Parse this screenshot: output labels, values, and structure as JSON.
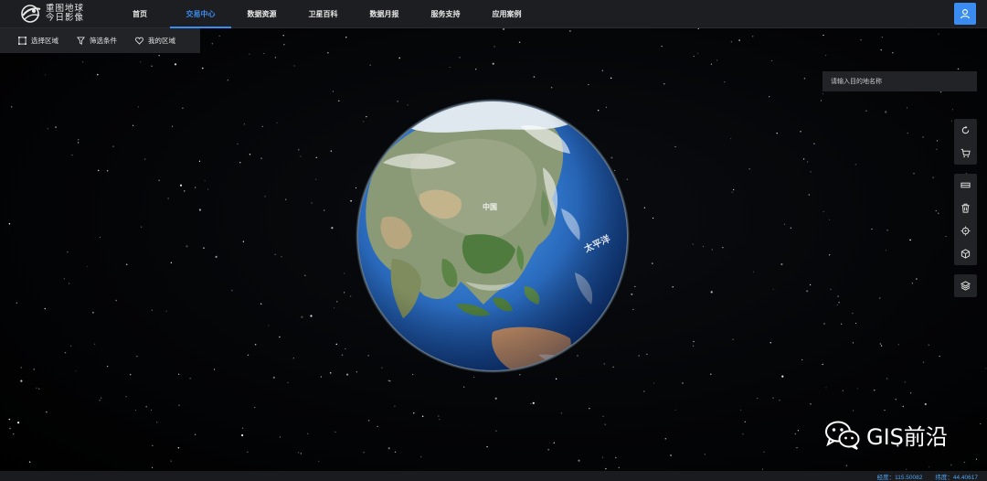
{
  "app": {
    "logo_line1": "重图地球",
    "logo_line2": "今日影像"
  },
  "nav": {
    "items": [
      {
        "label": "首页",
        "active": false
      },
      {
        "label": "交易中心",
        "active": true
      },
      {
        "label": "数据资源",
        "active": false
      },
      {
        "label": "卫星百科",
        "active": false
      },
      {
        "label": "数据月报",
        "active": false
      },
      {
        "label": "服务支持",
        "active": false
      },
      {
        "label": "应用案例",
        "active": false
      }
    ]
  },
  "toolbar": {
    "select_area": "选择区域",
    "filter": "筛选条件",
    "my_area": "我的区域"
  },
  "search": {
    "placeholder": "请输入目的地名称"
  },
  "globe": {
    "label_china": "中国",
    "label_pacific": "太平洋"
  },
  "status": {
    "longitude_label": "经度：",
    "longitude_value": "115.50082",
    "latitude_label": "纬度：",
    "latitude_value": "44.40617"
  },
  "watermark": {
    "text": "GIS前沿"
  },
  "colors": {
    "accent": "#3b8cf0",
    "bar": "#1d1e21",
    "panel": "#222326"
  }
}
